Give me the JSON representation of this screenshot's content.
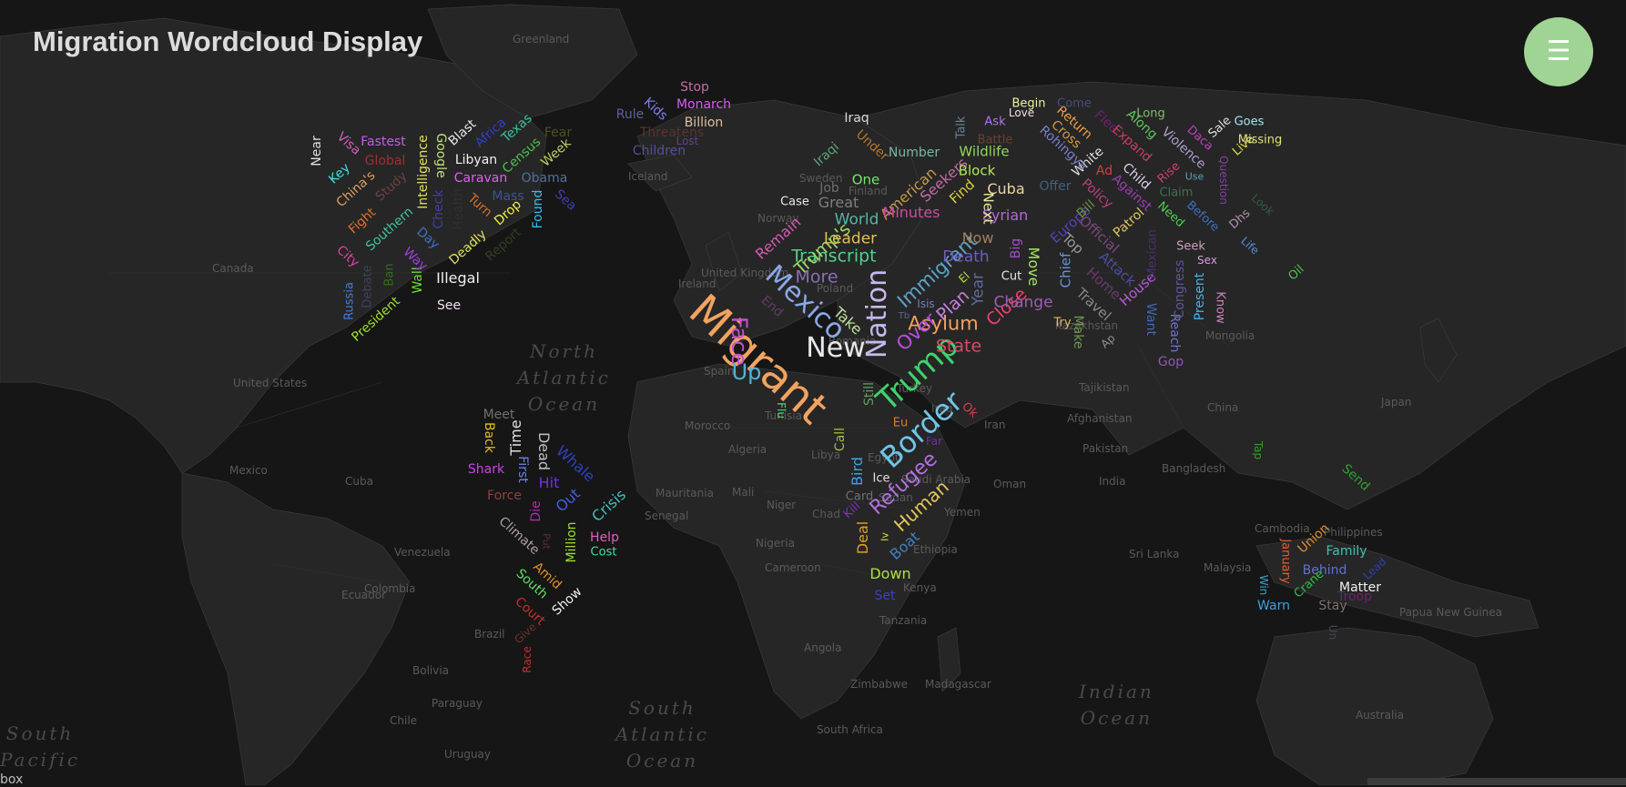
{
  "header": {
    "title": "Migration Wordcloud Display",
    "menu_icon": "☰",
    "bottom_label": "box"
  },
  "colors": {
    "menu_button": "#9fd495",
    "background": "#141414"
  },
  "map_labels": {
    "countries": [
      "Greenland",
      "Canada",
      "United States",
      "Mexico",
      "Cuba",
      "Venezuela",
      "Colombia",
      "Ecuador",
      "Brazil",
      "Bolivia",
      "Paraguay",
      "Chile",
      "Uruguay",
      "Iceland",
      "Norway",
      "Sweden",
      "Finland",
      "United Kingdom",
      "Ireland",
      "Spain",
      "Morocco",
      "Algeria",
      "Libya",
      "Egypt",
      "Tunisia",
      "Mauritania",
      "Mali",
      "Niger",
      "Chad",
      "Sudan",
      "Senegal",
      "Nigeria",
      "Cameroon",
      "Ethiopia",
      "Kenya",
      "Tanzania",
      "Angola",
      "Zimbabwe",
      "South Africa",
      "Madagascar",
      "Iran",
      "Iraq",
      "Afghanistan",
      "Pakistan",
      "India",
      "Tajikistan",
      "Kazakhstan",
      "Mongolia",
      "China",
      "Japan",
      "Bangladesh",
      "Sri Lanka",
      "Cambodia",
      "Philippines",
      "Malaysia",
      "Papua New Guinea",
      "Australia",
      "Yemen",
      "Oman",
      "Romania",
      "Poland",
      "Turkey",
      "Saudi Arabia"
    ],
    "oceans": [
      "North\nAtlantic\nOcean",
      "South\nAtlantic\nOcean",
      "Indian\nOcean",
      "South\nPacific"
    ]
  },
  "words": [
    "Migrant",
    "New",
    "Trump",
    "Border",
    "Mexico",
    "Nation",
    "Refugee",
    "Face",
    "Up",
    "Human",
    "Asylum",
    "State",
    "Over",
    "Immigrant",
    "Transcript",
    "Trump's",
    "Leader",
    "World",
    "More",
    "Close",
    "Plan",
    "Change",
    "Death",
    "Year",
    "Cuba",
    "Syrian",
    "Wildlife",
    "Block",
    "Now",
    "Find",
    "American",
    "Seekers",
    "Minutes",
    "Number",
    "One",
    "Great",
    "Job",
    "Case",
    "Remain",
    "Iraq",
    "Iraqi",
    "Under",
    "Talk",
    "Next",
    "Big",
    "Move",
    "Chief",
    "Top",
    "Europe",
    "Official",
    "Attack",
    "House",
    "Home",
    "Travel",
    "Make",
    "Want",
    "Reach",
    "Congress",
    "Present",
    "Know",
    "Gop",
    "Seek",
    "Sex",
    "Mexican",
    "Patrol",
    "Against",
    "Policy",
    "Child",
    "White",
    "Ad",
    "Rohingya",
    "Cross",
    "Return",
    "Flee",
    "Expand",
    "Along",
    "Violence",
    "Daca",
    "Sale",
    "Live",
    "Goes",
    "Missing",
    "Long",
    "Rise",
    "Use",
    "Claim",
    "Need",
    "Before",
    "Question",
    "Dhs",
    "Look",
    "Life",
    "Oil",
    "Begin",
    "Come",
    "Love",
    "Ask",
    "Battle",
    "Try",
    "Cut",
    "Ap",
    "El",
    "Isis",
    "Tb",
    "Ok",
    "Eu",
    "Far",
    "Still",
    "Call",
    "Bird",
    "Ice",
    "Card",
    "Kill",
    "Deal",
    "Iv",
    "Boat",
    "Down",
    "Set",
    "Flu",
    "End",
    "Take",
    "Offer",
    "Bill",
    "Stop",
    "Monarch",
    "Billion",
    "Lost",
    "Threatens",
    "Kids",
    "Rule",
    "Children",
    "Near",
    "Visa",
    "Fastest",
    "Global",
    "Key",
    "China's",
    "Study",
    "Fight",
    "City",
    "Russia",
    "Debate",
    "Ban",
    "President",
    "Southern",
    "Wall",
    "Way",
    "Illegal",
    "See",
    "Day",
    "Check",
    "Health",
    "Deadly",
    "Report",
    "Intelligence",
    "Google",
    "Blast",
    "Libyan",
    "Caravan",
    "Turn",
    "Drop",
    "Mass",
    "Found",
    "Obama",
    "Census",
    "Africa",
    "Texas",
    "Week",
    "Fear",
    "Sea",
    "Meet",
    "Back",
    "Time",
    "First",
    "Dead",
    "Whale",
    "Shark",
    "Hit",
    "Force",
    "Out",
    "Die",
    "Climate",
    "Put",
    "Million",
    "Crisis",
    "Help",
    "Cost",
    "Amid",
    "South",
    "Show",
    "Court",
    "Give",
    "Race",
    "Tap",
    "Send",
    "Union",
    "January",
    "Family",
    "Behind",
    "Lead",
    "Win",
    "Crane",
    "Matter",
    "Troop",
    "Warn",
    "Stay",
    "Un"
  ]
}
